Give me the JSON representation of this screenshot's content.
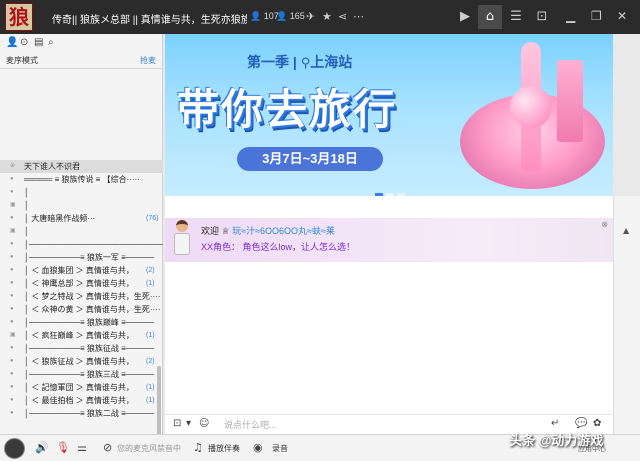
{
  "titlebar": {
    "logo_char": "狼",
    "title": "传奇|| 狼族メ总部 || 真情谁与共，生死亦狼族。",
    "online_count": "107",
    "member_count": "165",
    "nav_icons": [
      "video-icon",
      "home-icon",
      "list-icon",
      "gamepad-icon"
    ],
    "window_buttons": [
      "minimize-icon",
      "restore-icon",
      "close-icon"
    ]
  },
  "left_panel": {
    "toolbar_icons": [
      "user-icon",
      "location-icon",
      "note-icon",
      "search-icon"
    ],
    "mic_mode": "麦序模式",
    "grab_mic": "抢麦",
    "tree": [
      {
        "text": "天下谁人不识君",
        "count": "",
        "highlight": true
      },
      {
        "text": "═════ ≡  狼族传说  ≡      【综合·····",
        "count": ""
      },
      {
        "text": "│",
        "count": ""
      },
      {
        "text": "│",
        "count": ""
      },
      {
        "text": "│               大唐暗黑作战频···",
        "count": "(76)"
      },
      {
        "text": "│",
        "count": ""
      },
      {
        "text": "│─────────────────────────",
        "count": ""
      },
      {
        "text": "│─────────≡  狼族一军  ≡─────",
        "count": ""
      },
      {
        "text": "│ ＜ 血狼集团 ＞  真情谁与共，",
        "count": "(2)"
      },
      {
        "text": "│ ＜ 神鹰总部 ＞  真情谁与共，",
        "count": "(1)"
      },
      {
        "text": "│ ＜ 梦之特战 ＞  真情谁与共，生死····",
        "count": ""
      },
      {
        "text": "│ ＜ 众神の黄 ＞  真情谁与共，生死····",
        "count": ""
      },
      {
        "text": "│─────────≡  狼族巅峰  ≡─────",
        "count": ""
      },
      {
        "text": "│ ＜ 疯狂巅峰 ＞  真情谁与共，",
        "count": "(1)"
      },
      {
        "text": "│─────────≡  狼族征战  ≡─────",
        "count": ""
      },
      {
        "text": "│ ＜ 狼族征战 ＞  真情谁与共，",
        "count": "(2)"
      },
      {
        "text": "│─────────≡  狼族三战  ≡─────",
        "count": ""
      },
      {
        "text": "│ ＜ 記憶軍団 ＞  真情谁与共，",
        "count": "(1)"
      },
      {
        "text": "│ ＜ 最佳拍档 ＞  真情谁与共，",
        "count": "(1)"
      },
      {
        "text": "│─────────≡  狼族二战  ≡─────",
        "count": ""
      }
    ]
  },
  "banner": {
    "season": "第一季",
    "station": "上海站",
    "headline": "带你去旅行",
    "dates": "3月7日~3月18日",
    "active_slide": 1,
    "slide_count": 3
  },
  "chat": {
    "welcome_prefix": "欢迎",
    "username": "玩≈汁≈6OO6OO丸≈蚨≈莱",
    "line2": "XX角色：  角色这么low，让人怎么选！",
    "input_placeholder": "说点什么吧...",
    "input_value": ""
  },
  "bottombar": {
    "mic_off_text": "您的麦克风禁音中",
    "accompany": "播放伴奏",
    "record": "录音",
    "app_center": "应用中心"
  },
  "watermark": "头条 @动力游戏",
  "colors": {
    "titlebar_bg": "#2b2b2b",
    "banner_text": "#2360b8",
    "accent_blue": "#3a86d8",
    "message_purple": "#7a2ad8",
    "bottom_red": "#d8262c"
  }
}
